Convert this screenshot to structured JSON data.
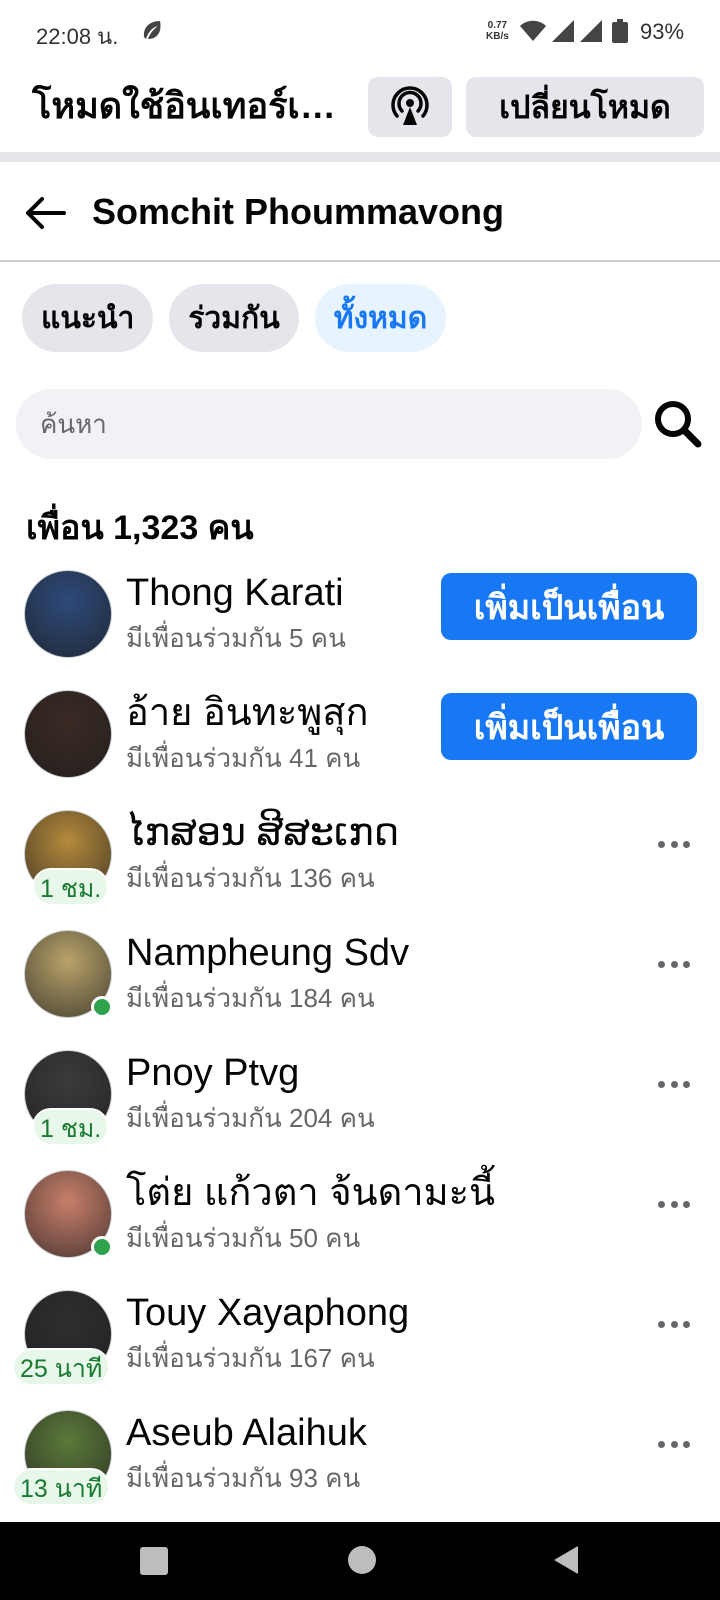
{
  "status_bar": {
    "time": "22:08 น.",
    "speed_value": "0.77",
    "speed_unit": "KB/s",
    "battery": "93%",
    "icons": [
      "leaf-icon",
      "wifi-icon",
      "signal-icon",
      "signal-icon",
      "battery-icon"
    ]
  },
  "mode_header": {
    "title": "โหมดใช้อินเทอร์เน็ตฟรี",
    "icon": "broadcast-icon",
    "switch_label": "เปลี่ยนโหมด"
  },
  "nav": {
    "title": "Somchit Phoummavong",
    "back_icon": "arrow-left-icon"
  },
  "chips": [
    {
      "label": "แนะนำ",
      "active": false
    },
    {
      "label": "ร่วมกัน",
      "active": false
    },
    {
      "label": "ทั้งหมด",
      "active": true
    }
  ],
  "search": {
    "placeholder": "ค้นหา",
    "value": ""
  },
  "friend_count": "เพื่อน 1,323 คน",
  "add_friend_label": "เพิ่มเป็นเพื่อน",
  "friends": [
    {
      "name": "Thong Karati",
      "mutual": "มีเพื่อนร่วมกัน 5 คน",
      "action": "add",
      "badge": "",
      "online": false,
      "avatar_color": "#2d4a7a"
    },
    {
      "name": "อ้าย อินทะพูสุก",
      "mutual": "มีเพื่อนร่วมกัน 41 คน",
      "action": "add",
      "badge": "",
      "online": false,
      "avatar_color": "#3a2a24"
    },
    {
      "name": "ໄກສອນ ສີສະເກດ",
      "mutual": "มีเพื่อนร่วมกัน 136 คน",
      "action": "more",
      "badge": "1 ชม.",
      "online": false,
      "avatar_color": "#b58a3c"
    },
    {
      "name": "Nampheung Sdv",
      "mutual": "มีเพื่อนร่วมกัน 184 คน",
      "action": "more",
      "badge": "",
      "online": true,
      "avatar_color": "#b9a36a"
    },
    {
      "name": "Pnoy Ptvg",
      "mutual": "มีเพื่อนร่วมกัน 204 คน",
      "action": "more",
      "badge": "1 ชม.",
      "online": false,
      "avatar_color": "#3b3b3b"
    },
    {
      "name": "โต่ย แก้วตา จ้นดามะนี้",
      "mutual": "มีเพื่อนร่วมกัน 50 คน",
      "action": "more",
      "badge": "",
      "online": true,
      "avatar_color": "#c87f6a"
    },
    {
      "name": "Touy Xayaphong",
      "mutual": "มีเพื่อนร่วมกัน 167 คน",
      "action": "more",
      "badge": "25 นาที",
      "online": false,
      "avatar_color": "#2f2f2f"
    },
    {
      "name": "Aseub Alaihuk",
      "mutual": "มีเพื่อนร่วมกัน 93 คน",
      "action": "more",
      "badge": "13 นาที",
      "online": false,
      "avatar_color": "#5c7a3a"
    }
  ],
  "colors": {
    "accent": "#1877f2",
    "chip_bg": "#e4e6eb",
    "chip_active_bg": "#e7f3ff",
    "secondary_text": "#65676b",
    "online": "#31a24c"
  }
}
